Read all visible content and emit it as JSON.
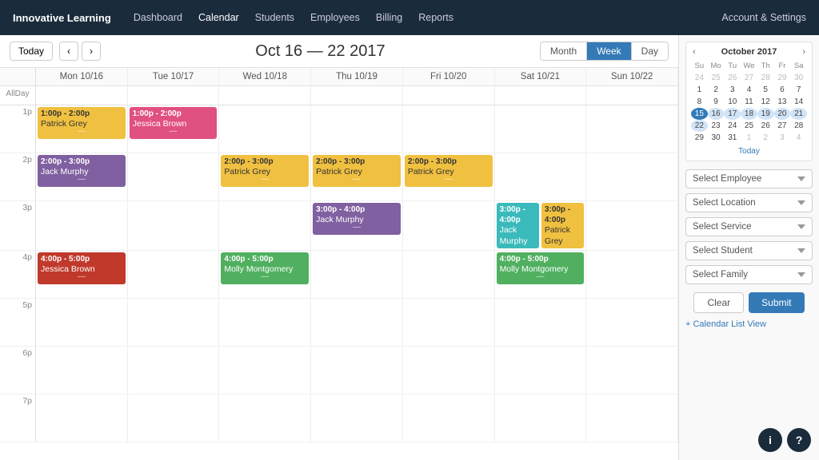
{
  "nav": {
    "brand": "Innovative Learning",
    "links": [
      "Dashboard",
      "Calendar",
      "Students",
      "Employees",
      "Billing",
      "Reports"
    ],
    "account": "Account & Settings"
  },
  "header": {
    "today_label": "Today",
    "title": "Oct 16 — 22 2017",
    "view_month": "Month",
    "view_week": "Week",
    "view_day": "Day"
  },
  "days": [
    {
      "label": "Mon 10/16"
    },
    {
      "label": "Tue 10/17"
    },
    {
      "label": "Wed 10/18"
    },
    {
      "label": "Thu 10/19"
    },
    {
      "label": "Fri 10/20"
    },
    {
      "label": "Sat 10/21"
    },
    {
      "label": "Sun 10/22"
    }
  ],
  "allday_label": "AllDay",
  "time_slots": [
    "1p",
    "2p",
    "3p",
    "4p",
    "5p",
    "6p",
    "7p"
  ],
  "mini_cal": {
    "title": "October 2017",
    "day_headers": [
      "Su",
      "Mo",
      "Tu",
      "We",
      "Th",
      "Fr",
      "Sa"
    ],
    "weeks": [
      [
        "24",
        "25",
        "26",
        "27",
        "28",
        "29",
        "30"
      ],
      [
        "1",
        "2",
        "3",
        "4",
        "5",
        "6",
        "7"
      ],
      [
        "8",
        "9",
        "10",
        "11",
        "12",
        "13",
        "14"
      ],
      [
        "15",
        "16",
        "17",
        "18",
        "19",
        "20",
        "21"
      ],
      [
        "22",
        "23",
        "24",
        "25",
        "26",
        "27",
        "28"
      ],
      [
        "29",
        "30",
        "31",
        "1",
        "2",
        "3",
        "4"
      ]
    ],
    "today_label": "Today",
    "today_date": "15"
  },
  "dropdowns": {
    "employee": "Select Employee",
    "location": "Select Location",
    "service": "Select Service",
    "student": "Select Student",
    "family": "Select Family"
  },
  "buttons": {
    "clear": "Clear",
    "submit": "Submit"
  },
  "cal_list_link": "+ Calendar List View",
  "events": {
    "mon_1p": {
      "time": "1:00p - 2:00p",
      "name": "Patrick Grey",
      "color": "yellow"
    },
    "tue_1p": {
      "time": "1:00p - 2:00p",
      "name": "Jessica Brown",
      "color": "pink"
    },
    "mon_2p": {
      "time": "2:00p - 3:00p",
      "name": "Jack Murphy",
      "color": "purple"
    },
    "wed_2p": {
      "time": "2:00p - 3:00p",
      "name": "Patrick Grey",
      "color": "yellow"
    },
    "thu_2p": {
      "time": "2:00p - 3:00p",
      "name": "Patrick Grey",
      "color": "yellow"
    },
    "fri_2p": {
      "time": "2:00p - 3:00p",
      "name": "Patrick Grey",
      "color": "yellow"
    },
    "thu_3p": {
      "time": "3:00p - 4:00p",
      "name": "Jack Murphy",
      "color": "purple"
    },
    "sat_3p_1": {
      "time": "3:00p - 4:00p",
      "name": "Jack Murphy",
      "color": "teal"
    },
    "sat_3p_2": {
      "time": "3:00p - 4:00p",
      "name": "Patrick Grey",
      "color": "yellow"
    },
    "wed_4p": {
      "time": "4:00p - 5:00p",
      "name": "Molly Montgomery",
      "color": "green"
    },
    "mon_4p": {
      "time": "4:00p - 5:00p",
      "name": "Jessica Brown",
      "color": "red"
    },
    "sat_4p": {
      "time": "4:00p - 5:00p",
      "name": "Molly Montgomery",
      "color": "green"
    }
  }
}
